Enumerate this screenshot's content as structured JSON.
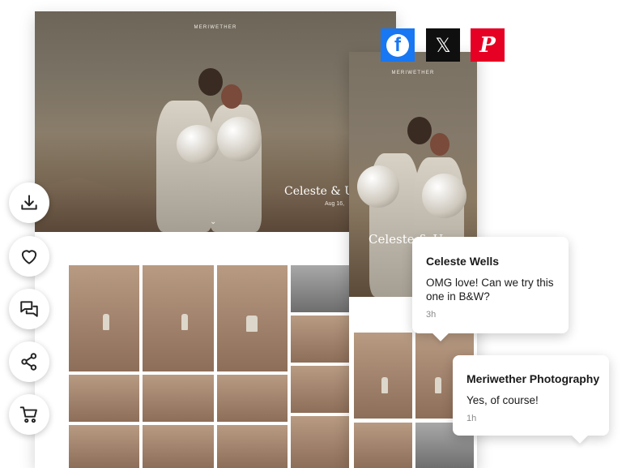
{
  "desktop": {
    "brand": "MERIWETHER",
    "title": "Celeste & Us",
    "date": "Aug 16,",
    "chevron": "⌄"
  },
  "mobile": {
    "brand": "MERIWETHER",
    "title": "Celeste & U"
  },
  "social": {
    "facebook": {
      "glyph": "f",
      "color": "#1877f2",
      "icon": "facebook-icon"
    },
    "x": {
      "glyph": "𝕏",
      "color": "#0f0f0f",
      "icon": "x-icon"
    },
    "pinterest": {
      "glyph": "P",
      "color": "#e60023",
      "icon": "pinterest-icon"
    }
  },
  "actions": [
    "download-icon",
    "heart-icon",
    "comments-icon",
    "share-icon",
    "cart-icon"
  ],
  "comments": [
    {
      "name": "Celeste Wells",
      "message": "OMG love! Can we try this one in B&W?",
      "time": "3h"
    },
    {
      "name": "Meriwether Photography",
      "message": "Yes, of course!",
      "time": "1h"
    }
  ]
}
